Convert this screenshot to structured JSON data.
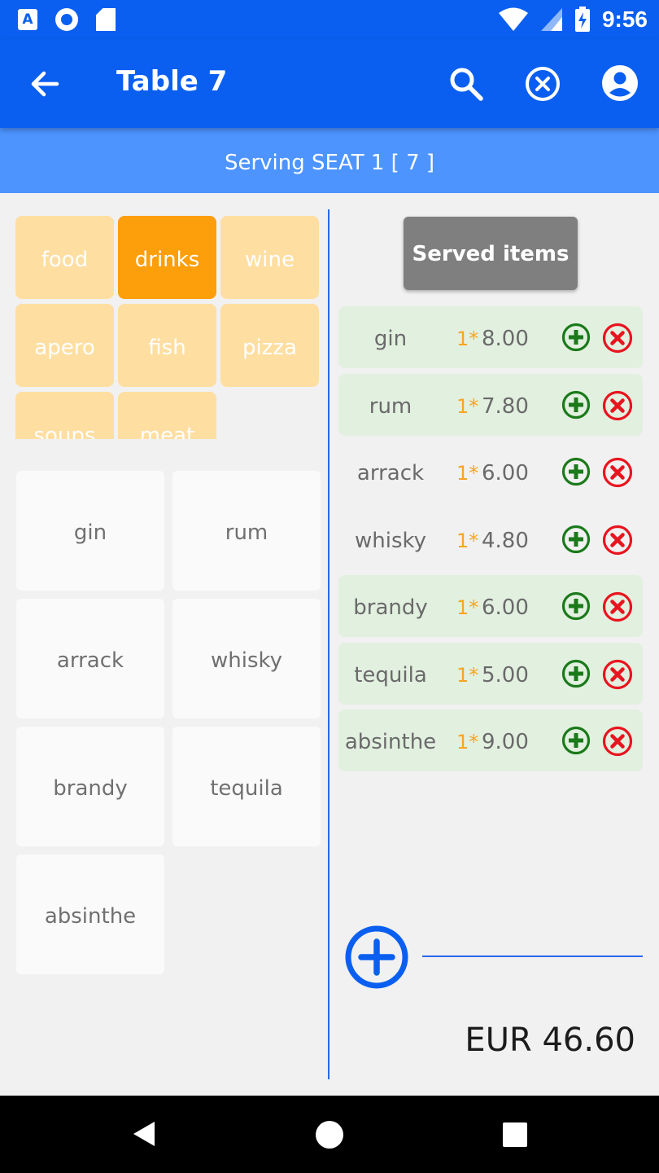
{
  "status_bar": {
    "time": "9:56",
    "icons": [
      "app-a-icon",
      "circle-icon",
      "sd-card-icon",
      "wifi-icon",
      "signal-icon",
      "battery-charging-icon"
    ]
  },
  "app_bar": {
    "title": "Table 7",
    "icons": [
      "back-arrow-icon",
      "search-icon",
      "cancel-icon",
      "account-icon"
    ]
  },
  "seat_bar": {
    "text": "Serving SEAT 1  [ 7 ]"
  },
  "categories": [
    {
      "label": "food",
      "active": false
    },
    {
      "label": "drinks",
      "active": true
    },
    {
      "label": "wine",
      "active": false
    },
    {
      "label": "apero",
      "active": false
    },
    {
      "label": "fish",
      "active": false
    },
    {
      "label": "pizza",
      "active": false
    },
    {
      "label": "soups",
      "active": false
    },
    {
      "label": "meat",
      "active": false
    }
  ],
  "menu_items": [
    "gin",
    "rum",
    "arrack",
    "whisky",
    "brandy",
    "tequila",
    "absinthe"
  ],
  "served": {
    "button_label": "Served items",
    "items": [
      {
        "name": "gin",
        "qty": "1*",
        "price": "8.00",
        "highlight": true
      },
      {
        "name": "rum",
        "qty": "1*",
        "price": "7.80",
        "highlight": true
      },
      {
        "name": "arrack",
        "qty": "1*",
        "price": "6.00",
        "highlight": false
      },
      {
        "name": "whisky",
        "qty": "1*",
        "price": "4.80",
        "highlight": false
      },
      {
        "name": "brandy",
        "qty": "1*",
        "price": "6.00",
        "highlight": true
      },
      {
        "name": "tequila",
        "qty": "1*",
        "price": "5.00",
        "highlight": true
      },
      {
        "name": "absinthe",
        "qty": "1*",
        "price": "9.00",
        "highlight": true
      }
    ]
  },
  "total": "EUR 46.60",
  "colors": {
    "primary": "#0a5ff0",
    "seat_bar": "#4d94ff",
    "category": "#fedea1",
    "category_active": "#fd9e0b",
    "row_highlight": "#e2f0e0",
    "add": "#1a7a1a",
    "remove": "#e8141e",
    "quantity": "#f5a623"
  }
}
